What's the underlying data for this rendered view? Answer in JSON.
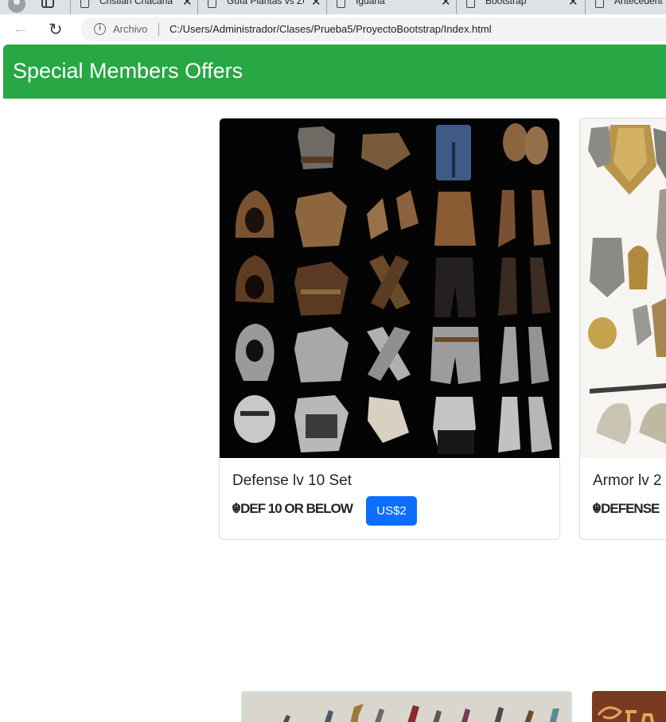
{
  "browser": {
    "tabs": [
      {
        "title": "Cristian Chacana"
      },
      {
        "title": "Guía Plantas vs Zo"
      },
      {
        "title": "Iguana"
      },
      {
        "title": "Bootstrap"
      },
      {
        "title": "Antecedent"
      }
    ],
    "site_label": "Archivo",
    "url": "C:/Users/Administrador/Clases/Prueba5/ProyectoBootstrap/Index.html"
  },
  "hero": {
    "title": "Special Members Offers"
  },
  "offers": [
    {
      "title": "Defense lv 10 Set",
      "subtitle": "☬DEF 10 OR BELOW",
      "price": "US$2"
    },
    {
      "title": "Armor lv 2",
      "subtitle": "☬DEFENSE"
    }
  ],
  "colors": {
    "hero_bg": "#28a745",
    "button_bg": "#0d6efd"
  }
}
